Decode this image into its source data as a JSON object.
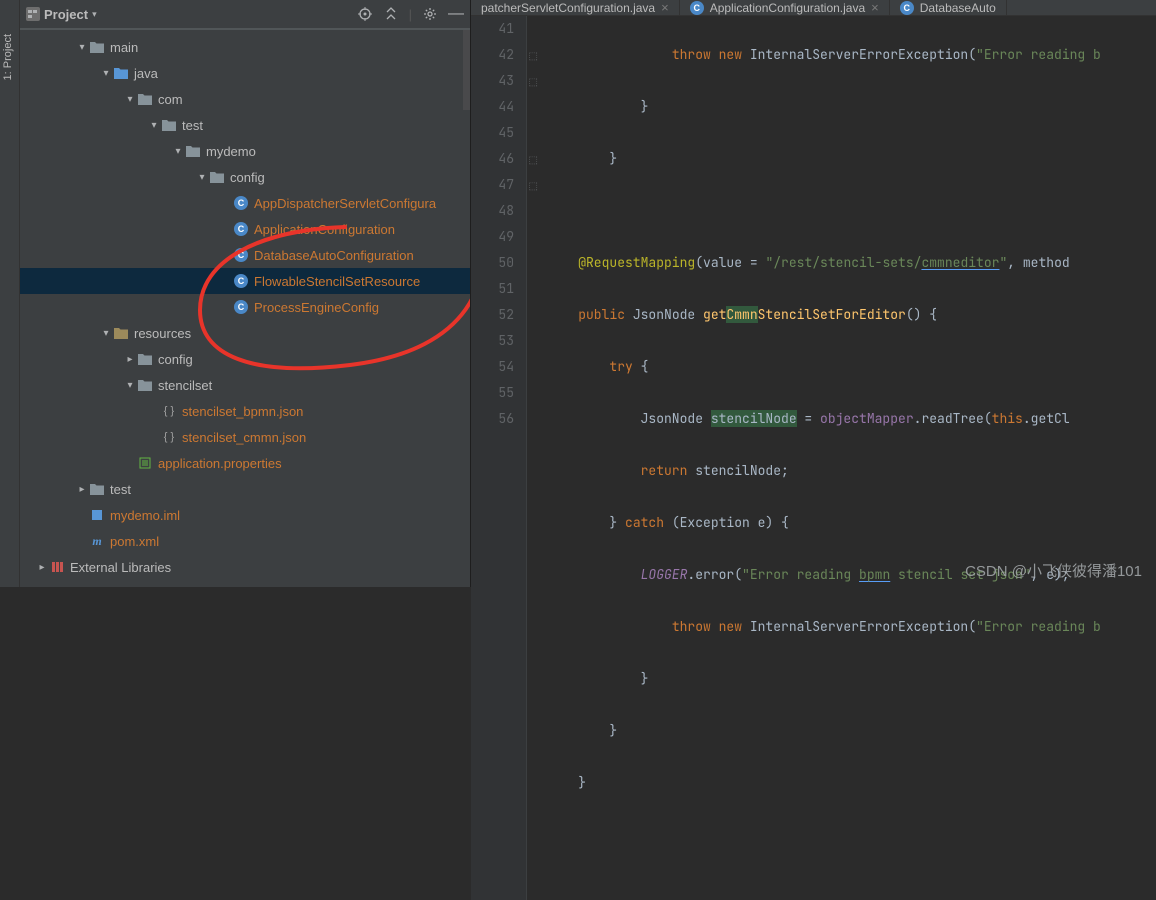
{
  "panel": {
    "title": "Project",
    "actions": [
      "target-icon",
      "collapse-icon",
      "gear-icon",
      "hide-icon"
    ]
  },
  "side_tab": "1: Project",
  "tree": {
    "main": "main",
    "java": "java",
    "com": "com",
    "test": "test",
    "mydemo": "mydemo",
    "config": "config",
    "files": {
      "c0": "AppDispatcherServletConfigura",
      "c1": "ApplicationConfiguration",
      "c2": "DatabaseAutoConfiguration",
      "c3": "FlowableStencilSetResource",
      "c4": "ProcessEngineConfig"
    },
    "resources": "resources",
    "config2": "config",
    "stencilset": "stencilset",
    "s1": "stencilset_bpmn.json",
    "s2": "stencilset_cmmn.json",
    "app_props": "application.properties",
    "test2": "test",
    "iml": "mydemo.iml",
    "pom": "pom.xml",
    "ext": "External Libraries"
  },
  "tabs": {
    "t0": "patcherServletConfiguration.java",
    "t1": "ApplicationConfiguration.java",
    "t2": "DatabaseAuto"
  },
  "gutter": [
    "41",
    "42",
    "43",
    "44",
    "45",
    "46",
    "47",
    "48",
    "49",
    "50",
    "51",
    "52",
    "53",
    "54",
    "55",
    "56"
  ],
  "code": {
    "l41a": "throw new ",
    "l41b": "InternalServerErrorException(",
    "l41c": "\"Error reading b",
    "l42": "            }",
    "l43": "        }",
    "l44": "",
    "l45a": "@RequestMapping",
    "l45b": "(",
    "l45c": "value = ",
    "l45d": "\"/rest/stencil-sets/",
    "l45e": "cmmneditor",
    "l45f": "\"",
    "l45g": ", method",
    "l46a": "public ",
    "l46b": "JsonNode ",
    "l46c": "get",
    "l46d": "Cmmn",
    "l46e": "StencilSetForEditor",
    "l46f": "() {",
    "l47a": "try ",
    "l47b": "{",
    "l48a": "JsonNode ",
    "l48b": "stencilNode",
    "l48c": " = ",
    "l48d": "objectMapper",
    "l48e": ".readTree(",
    "l48f": "this",
    "l48g": ".getCl",
    "l49a": "return ",
    "l49b": "stencilNode;",
    "l50a": "} ",
    "l50b": "catch ",
    "l50c": "(Exception e) {",
    "l51a": "LOGGER",
    "l51b": ".error(",
    "l51c": "\"Error reading ",
    "l51d": "bpmn",
    "l51e": " stencil set json\"",
    "l51f": ", e);",
    "l52a": "throw new ",
    "l52b": "InternalServerErrorException(",
    "l52c": "\"Error reading b",
    "l53": "            }",
    "l54": "        }",
    "l55": "    }",
    "l56": ""
  },
  "watermark": "CSDN @小飞侠彼得潘101"
}
